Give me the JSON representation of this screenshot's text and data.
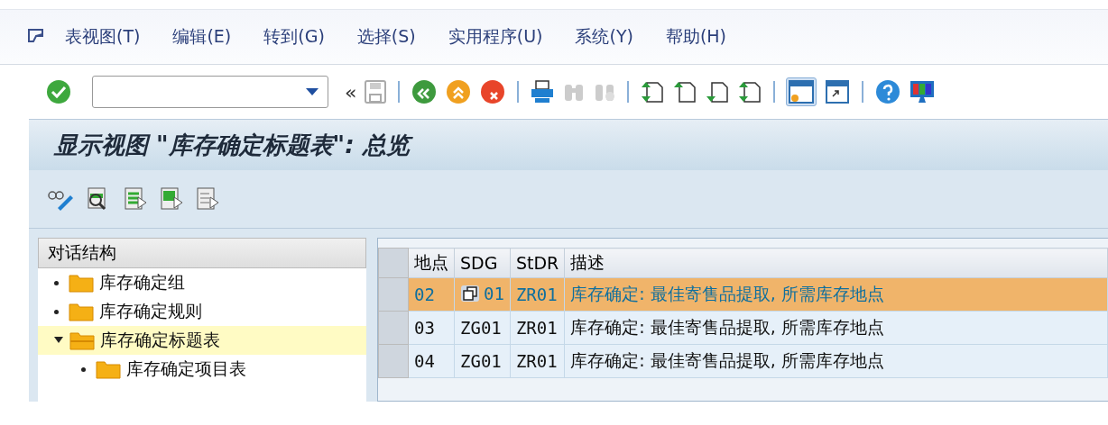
{
  "menu_bar": {
    "items": [
      "表视图(T)",
      "编辑(E)",
      "转到(G)",
      "选择(S)",
      "实用程序(U)",
      "系统(Y)",
      "帮助(H)"
    ]
  },
  "toolbar": {
    "history_symbol": "«"
  },
  "title_bar": {
    "title": "显示视图 \"库存确定标题表\": 总览"
  },
  "dialog_structure": {
    "heading": "对话结构",
    "items": [
      {
        "label": "库存确定组",
        "selected": false,
        "expanded": false
      },
      {
        "label": "库存确定规则",
        "selected": false,
        "expanded": false
      },
      {
        "label": "库存确定标题表",
        "selected": true,
        "expanded": true,
        "children": [
          {
            "label": "库存确定项目表",
            "selected": false,
            "expanded": false
          }
        ]
      }
    ]
  },
  "table": {
    "columns": [
      "地点",
      "SDG",
      "StDR",
      "描述"
    ],
    "rows": [
      {
        "cells": [
          "02",
          "01",
          "ZR01",
          "库存确定: 最佳寄售品提取, 所需库存地点"
        ],
        "selected": true
      },
      {
        "cells": [
          "03",
          "ZG01",
          "ZR01",
          "库存确定: 最佳寄售品提取, 所需库存地点"
        ],
        "selected": false
      },
      {
        "cells": [
          "04",
          "ZG01",
          "ZR01",
          "库存确定: 最佳寄售品提取, 所需库存地点"
        ],
        "selected": false
      }
    ]
  }
}
